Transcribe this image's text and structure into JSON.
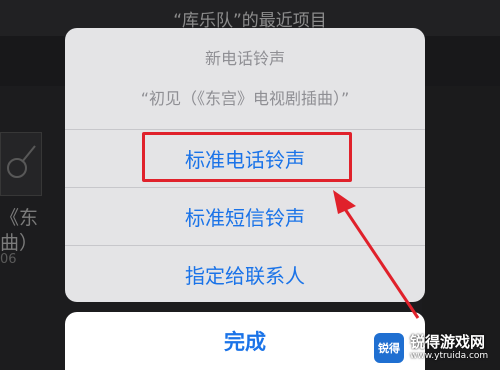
{
  "screen": {
    "title": "“库乐队”的最近项目",
    "bg_item_line1": "《东",
    "bg_item_line2": "曲）",
    "bg_item_meta": "06"
  },
  "action_sheet": {
    "title": "新电话铃声",
    "message": "“初见（《东宫》电视剧插曲）”",
    "options": [
      {
        "label": "标准电话铃声",
        "highlighted": true
      },
      {
        "label": "标准短信铃声",
        "highlighted": false
      },
      {
        "label": "指定给联系人",
        "highlighted": false
      }
    ],
    "done_label": "完成"
  },
  "annotation": {
    "color": "#e0212b",
    "icon": "red-arrow-icon"
  },
  "watermark": {
    "logo_text": "锐得",
    "main_text": "锐得游戏网",
    "sub_text": "www.ytruida.com"
  },
  "colors": {
    "accent_blue": "#1a73e8",
    "sheet_bg": "#e4e4e6",
    "highlight_red": "#e0212b"
  }
}
